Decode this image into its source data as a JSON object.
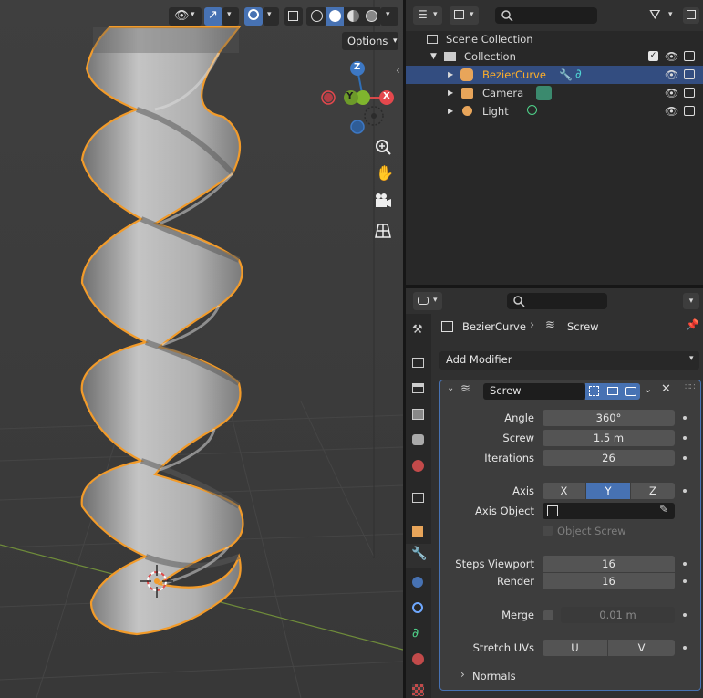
{
  "viewport": {
    "options_label": "Options",
    "gizmo": {
      "z": "Z",
      "y": "Y",
      "x": "X"
    }
  },
  "outliner": {
    "scene_collection": "Scene Collection",
    "collection": "Collection",
    "objects": [
      {
        "name": "BezierCurve"
      },
      {
        "name": "Camera"
      },
      {
        "name": "Light"
      }
    ]
  },
  "properties": {
    "breadcrumb": {
      "object": "BezierCurve",
      "modifier": "Screw"
    },
    "add_modifier": "Add Modifier",
    "modifier_name": "Screw",
    "fields": {
      "angle_label": "Angle",
      "angle_value": "360°",
      "screw_label": "Screw",
      "screw_value": "1.5 m",
      "iterations_label": "Iterations",
      "iterations_value": "26",
      "axis_label": "Axis",
      "axis_x": "X",
      "axis_y": "Y",
      "axis_z": "Z",
      "axis_object_label": "Axis Object",
      "object_screw_label": "Object Screw",
      "steps_viewport_label": "Steps Viewport",
      "steps_viewport_value": "16",
      "render_label": "Render",
      "render_value": "16",
      "merge_label": "Merge",
      "merge_value": "0.01 m",
      "stretch_uvs_label": "Stretch UVs",
      "stretch_u": "U",
      "stretch_v": "V",
      "normals_label": "Normals"
    }
  },
  "colors": {
    "accent": "#4772b3",
    "selection_orange": "#ffaf29",
    "outline": "#f29b2a"
  }
}
